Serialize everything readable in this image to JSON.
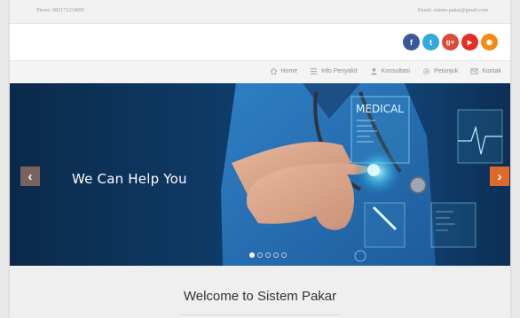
{
  "topbar": {
    "phone": "Phone: 082171234695",
    "email": "Email: sistem-pakar@gmail.com"
  },
  "social": [
    {
      "icon": "facebook-icon",
      "glyph": "f",
      "color": "#3b5998"
    },
    {
      "icon": "twitter-icon",
      "glyph": "t",
      "color": "#33aadd"
    },
    {
      "icon": "google-plus-icon",
      "glyph": "g+",
      "color": "#dd4b39"
    },
    {
      "icon": "youtube-icon",
      "glyph": "▶",
      "color": "#e52d27"
    },
    {
      "icon": "rss-icon",
      "glyph": "◉",
      "color": "#f28b16"
    }
  ],
  "nav": {
    "items": [
      {
        "label": "Home",
        "icon": "home-icon"
      },
      {
        "label": "Info Penyakit",
        "icon": "list-icon"
      },
      {
        "label": "Konsultasi",
        "icon": "user-icon"
      },
      {
        "label": "Petunjuk",
        "icon": "gear-icon"
      },
      {
        "label": "Kontak",
        "icon": "mail-icon"
      }
    ]
  },
  "slider": {
    "caption": "We Can Help You",
    "overlay_text": "MEDICAL",
    "prev_glyph": "‹",
    "next_glyph": "›",
    "slide_count": 5,
    "active_slide": 1
  },
  "welcome": {
    "title": "Welcome to Sistem Pakar"
  }
}
